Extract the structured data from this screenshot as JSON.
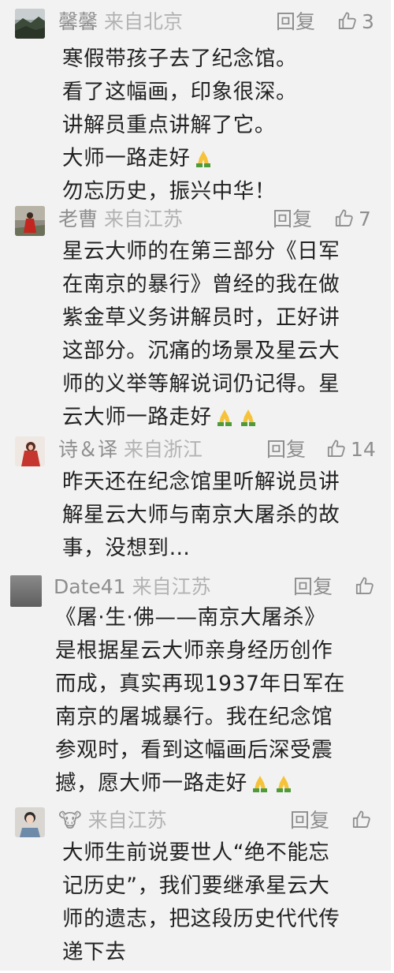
{
  "comments": [
    {
      "user": "馨馨",
      "location": "来自北京",
      "reply_label": "回复",
      "likes": "3",
      "avatar": "landscape-photo",
      "lines": [
        "寒假带孩子去了纪念馆。",
        "看了这幅画，印象很深。",
        "讲解员重点讲解了它。",
        "大师一路走好",
        "勿忘历史，振兴中华！"
      ]
    },
    {
      "user": "老曹",
      "location": "来自江苏",
      "reply_label": "回复",
      "likes": "7",
      "avatar": "person-red-dress-photo",
      "lines": [
        "星云大师的在第三部分《日军",
        "在南京的暴行》曾经的我在做",
        "紫金草义务讲解员时，正好讲",
        "这部分。沉痛的场景及星云大",
        "师的义举等解说词仍记得。星",
        "云大师一路走好"
      ]
    },
    {
      "user": "诗＆译",
      "location": "来自浙江",
      "reply_label": "回复",
      "likes": "14",
      "avatar": "person-red-outfit-photo",
      "lines": [
        "昨天还在纪念馆里听解说员讲",
        "解星云大师与南京大屠杀的故",
        "事，没想到…"
      ]
    },
    {
      "user": "Date41",
      "location": "来自江苏",
      "reply_label": "回复",
      "likes": "",
      "avatar": "gray-abstract-photo",
      "lines": [
        "《屠·生·佛——南京大屠杀》",
        "是根据星云大师亲身经历创作",
        "而成，真实再现1937年日军在",
        "南京的屠城暴行。我在纪念馆",
        "参观时，看到这幅画后深受震",
        "撼，愿大师一路走好"
      ]
    },
    {
      "user": "🐮",
      "location": "来自江苏",
      "reply_label": "回复",
      "likes": "",
      "avatar": "child-photo",
      "lines": [
        "大师生前说要世人“绝不能忘",
        "记历史”，我们要继承星云大",
        "师的遗志，把这段历史代代传",
        "递下去"
      ]
    }
  ],
  "icons": {
    "like": "thumbs-up-outline-icon",
    "emoji": "folded-hands-emoji"
  },
  "colors": {
    "background": "#f2f2f2",
    "meta_text": "#8e8e8e",
    "location_text": "#b3b3b3",
    "body_text": "#222222",
    "emoji_skin": "#f5c23a",
    "emoji_sleeve": "#4f9a3a"
  }
}
